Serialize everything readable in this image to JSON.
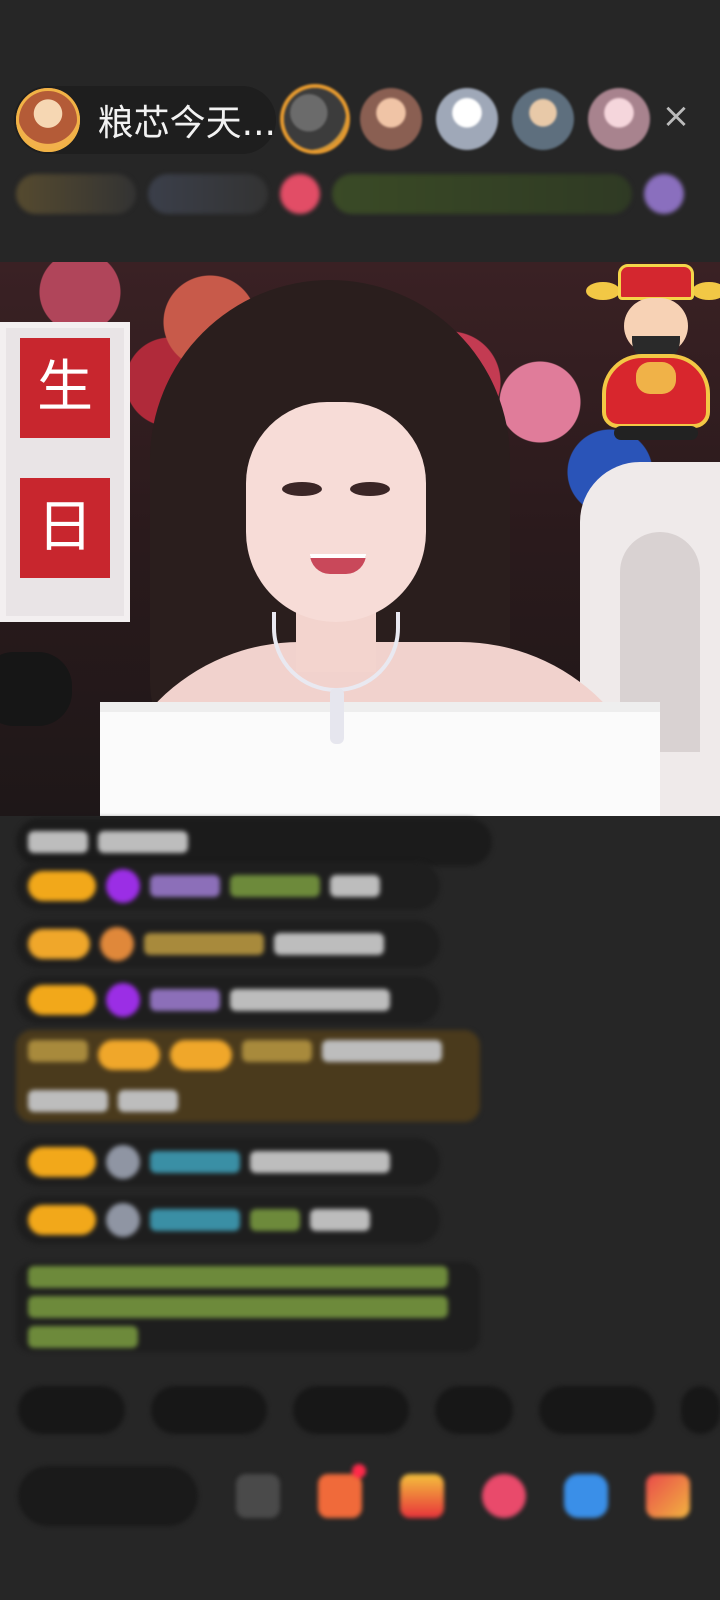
{
  "header": {
    "host_name": "粮芯今天...",
    "close_icon": "×"
  },
  "viewers": [
    {
      "icon": "viewer-avatar-1"
    },
    {
      "icon": "viewer-avatar-2"
    },
    {
      "icon": "viewer-avatar-3"
    },
    {
      "icon": "viewer-avatar-4"
    },
    {
      "icon": "viewer-avatar-5"
    }
  ],
  "stream": {
    "sign_chars": [
      "生",
      "日"
    ]
  },
  "colors": {
    "background": "#262626",
    "badge_gold": "#f2a81a",
    "gem_purple": "#9b2ee5",
    "highlight_bubble": "#4a3a1c"
  }
}
